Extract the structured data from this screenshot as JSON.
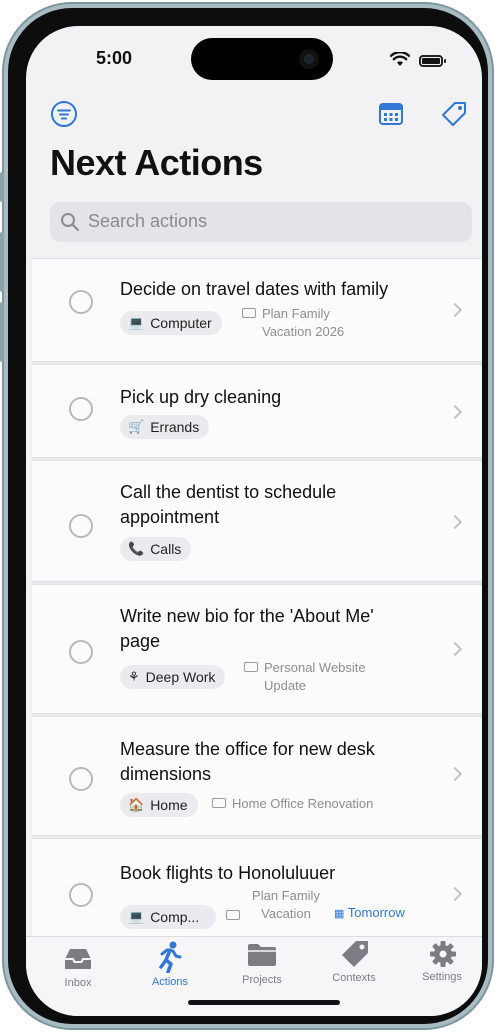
{
  "status_bar": {
    "time": "5:00"
  },
  "header": {
    "title": "Next Actions",
    "search_placeholder": "Search actions"
  },
  "tasks": [
    {
      "title": "Decide on travel dates with family",
      "context": "Computer",
      "context_icon": "laptop-icon",
      "project": "Plan Family Vacation 2026"
    },
    {
      "title": "Pick up dry cleaning",
      "context": "Errands",
      "context_icon": "cart-icon"
    },
    {
      "title": "Call the dentist to schedule appointment",
      "context": "Calls",
      "context_icon": "phone-icon"
    },
    {
      "title": "Write new bio for the 'About Me' page",
      "context": "Deep Work",
      "context_icon": "focus-icon",
      "project": "Personal Website Update"
    },
    {
      "title": "Measure the office for new desk dimensions",
      "context": "Home",
      "context_icon": "house-icon",
      "project": "Home Office Renovation"
    },
    {
      "title": "Book flights to Honoluluuer",
      "context": "Comp...",
      "context_icon": "laptop-icon",
      "project": "Plan Family Vacation",
      "due": "Tomorrow"
    }
  ],
  "tabs": [
    {
      "label": "Inbox",
      "icon": "inbox-icon"
    },
    {
      "label": "Actions",
      "icon": "running-person-icon",
      "active": true
    },
    {
      "label": "Projects",
      "icon": "folder-icon"
    },
    {
      "label": "Contexts",
      "icon": "tag-icon"
    },
    {
      "label": "Settings",
      "icon": "gear-icon"
    }
  ],
  "colors": {
    "accent": "#2f78d6",
    "background": "#f2f2f4",
    "card": "#fbfbfc",
    "chip": "#ebebef"
  }
}
